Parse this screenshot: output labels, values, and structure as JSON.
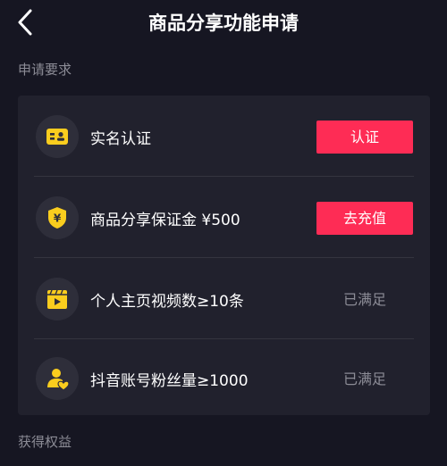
{
  "header": {
    "title": "商品分享功能申请",
    "back_icon": "chevron-left-icon"
  },
  "sections": {
    "requirements_title": "申请要求",
    "benefits_title": "获得权益"
  },
  "requirements": [
    {
      "icon": "id-card-icon",
      "label": "实名认证",
      "action": "认证",
      "done": false
    },
    {
      "icon": "shield-yen-icon",
      "label": "商品分享保证金 ¥500",
      "action": "去充值",
      "done": false
    },
    {
      "icon": "video-clapper-icon",
      "label": "个人主页视频数≥10条",
      "status": "已满足",
      "done": true
    },
    {
      "icon": "fans-icon",
      "label": "抖音账号粉丝量≥1000",
      "status": "已满足",
      "done": true
    }
  ],
  "colors": {
    "background": "#161622",
    "card": "#21212d",
    "accent": "#fe2c55",
    "icon_yellow": "#facd1e",
    "muted_text": "#8c8c96"
  }
}
